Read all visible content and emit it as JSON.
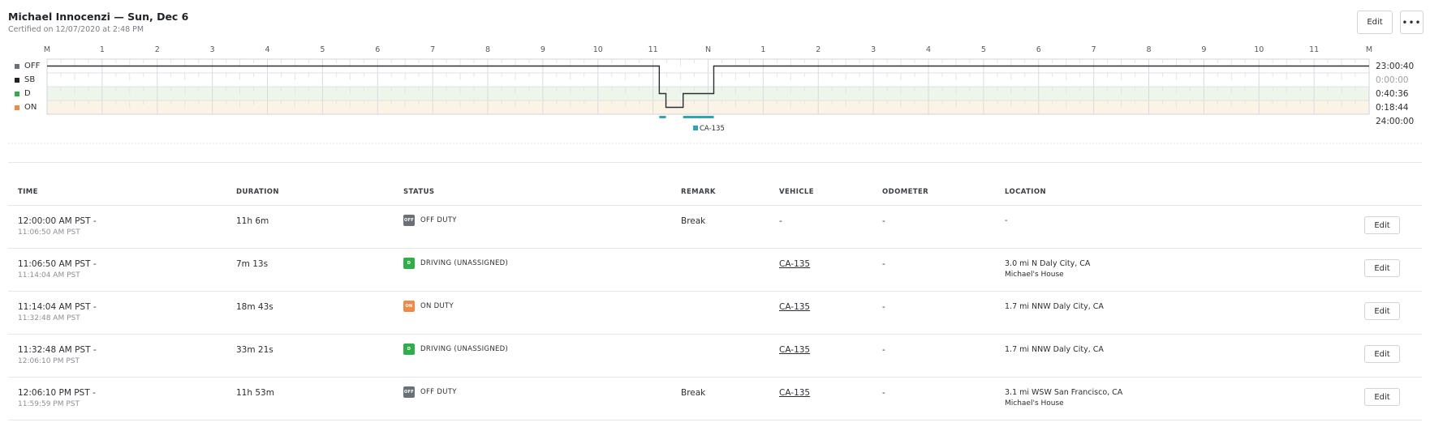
{
  "header": {
    "title": "Michael Innocenzi — Sun, Dec 6",
    "subtitle": "Certified on 12/07/2020 at 2:48 PM",
    "edit_label": "Edit",
    "more_label": "•••"
  },
  "graph": {
    "hour_labels": [
      "M",
      "1",
      "2",
      "3",
      "4",
      "5",
      "6",
      "7",
      "8",
      "9",
      "10",
      "11",
      "N",
      "1",
      "2",
      "3",
      "4",
      "5",
      "6",
      "7",
      "8",
      "9",
      "10",
      "11",
      "M"
    ],
    "legend": [
      {
        "label": "OFF",
        "color": "#6b7178"
      },
      {
        "label": "SB",
        "color": "#1f2328"
      },
      {
        "label": "D",
        "color": "#2fae4a"
      },
      {
        "label": "ON",
        "color": "#f08a4b"
      }
    ],
    "totals": [
      "23:00:40",
      "0:00:00",
      "0:40:36",
      "0:18:44"
    ],
    "grand_total": "24:00:00",
    "vehicle_marker": "CA-135",
    "marker_color": "#2aa6b5",
    "line_color": "#2b2f33",
    "status_segments": [
      {
        "status": "OFF",
        "start": "0:00:00",
        "end": "11:06:50"
      },
      {
        "status": "D",
        "start": "11:06:50",
        "end": "11:14:04"
      },
      {
        "status": "ON",
        "start": "11:14:04",
        "end": "11:32:48"
      },
      {
        "status": "D",
        "start": "11:32:48",
        "end": "12:06:10"
      },
      {
        "status": "OFF",
        "start": "12:06:10",
        "end": "23:59:59"
      }
    ],
    "vehicle_spans": [
      {
        "start": "11:06:50",
        "end": "11:14:04"
      },
      {
        "start": "11:32:48",
        "end": "12:06:10"
      }
    ]
  },
  "table": {
    "headers": [
      "TIME",
      "DURATION",
      "STATUS",
      "REMARK",
      "VEHICLE",
      "ODOMETER",
      "LOCATION"
    ],
    "edit_label": "Edit",
    "rows": [
      {
        "time_start": "12:00:00 AM PST -",
        "time_end": "11:06:50 AM PST",
        "duration": "11h 6m",
        "status": "OFF DUTY",
        "badge": "OFF",
        "badge_color": "#6b7178",
        "remark": "Break",
        "vehicle": "-",
        "vehicle_link": false,
        "odometer": "-",
        "location": "-",
        "location2": ""
      },
      {
        "time_start": "11:06:50 AM PST -",
        "time_end": "11:14:04 AM PST",
        "duration": "7m 13s",
        "status": "DRIVING (UNASSIGNED)",
        "badge": "D",
        "badge_color": "#2fae4a",
        "remark": "",
        "vehicle": "CA-135",
        "vehicle_link": true,
        "odometer": "-",
        "location": "3.0 mi N Daly City, CA",
        "location2": "Michael's House"
      },
      {
        "time_start": "11:14:04 AM PST -",
        "time_end": "11:32:48 AM PST",
        "duration": "18m 43s",
        "status": "ON DUTY",
        "badge": "ON",
        "badge_color": "#f08a4b",
        "remark": "",
        "vehicle": "CA-135",
        "vehicle_link": true,
        "odometer": "-",
        "location": "1.7 mi NNW Daly City, CA",
        "location2": ""
      },
      {
        "time_start": "11:32:48 AM PST -",
        "time_end": "12:06:10 PM PST",
        "duration": "33m 21s",
        "status": "DRIVING (UNASSIGNED)",
        "badge": "D",
        "badge_color": "#2fae4a",
        "remark": "",
        "vehicle": "CA-135",
        "vehicle_link": true,
        "odometer": "-",
        "location": "1.7 mi NNW Daly City, CA",
        "location2": ""
      },
      {
        "time_start": "12:06:10 PM PST -",
        "time_end": "11:59:59 PM PST",
        "duration": "11h 53m",
        "status": "OFF DUTY",
        "badge": "OFF",
        "badge_color": "#6b7178",
        "remark": "Break",
        "vehicle": "CA-135",
        "vehicle_link": true,
        "odometer": "-",
        "location": "3.1 mi WSW San Francisco, CA",
        "location2": "Michael's House"
      }
    ]
  }
}
